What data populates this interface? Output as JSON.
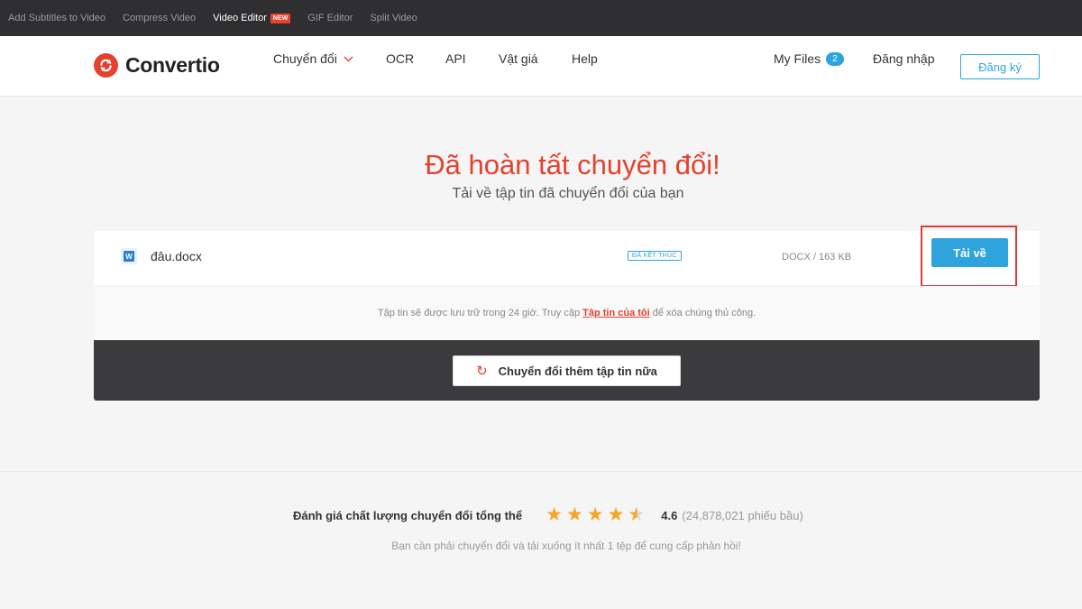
{
  "topbar": {
    "links": [
      "Add Subtitles to Video",
      "Compress Video",
      "Video Editor",
      "GIF Editor",
      "Split Video"
    ],
    "new_badge": "NEW"
  },
  "header": {
    "brand": "Convertio",
    "nav": {
      "convert": "Chuyển đổi",
      "ocr": "OCR",
      "api": "API",
      "pricing": "Vật giá",
      "help": "Help"
    },
    "my_files": "My Files",
    "my_files_count": "2",
    "login": "Đăng nhập",
    "register": "Đăng ký"
  },
  "hero": {
    "title": "Đã hoàn tất chuyển đổi!",
    "subtitle": "Tải về tập tin đã chuyển đổi của bạn"
  },
  "file": {
    "icon": "word-document-icon",
    "icon_letter": "W",
    "name": "đâu.docx",
    "status": "ĐÃ KẾT THÚC",
    "meta": "DOCX / 163 KB",
    "download_label": "Tải về"
  },
  "notice": {
    "before": "Tập tin sẽ được lưu trữ trong 24 giờ. Truy cập ",
    "link": "Tập tin của tôi",
    "after": " để xóa chúng thủ công."
  },
  "convert_more": {
    "icon": "refresh-icon",
    "label": "Chuyển đổi thêm tập tin nữa"
  },
  "rating": {
    "label": "Đánh giá chất lượng chuyển đổi tổng thể",
    "score": "4.6",
    "score_value": 4.6,
    "score_max": 5,
    "votes": "(24,878,021 phiếu bầu)",
    "feedback": "Bạn cần phải chuyển đổi và tải xuống ít nhất 1 tệp để cung cấp phản hồi!"
  },
  "colors": {
    "brand_red": "#e5412d",
    "accent_blue": "#2fa3dc",
    "highlight_box": "#e53935",
    "star": "#f5a623"
  }
}
